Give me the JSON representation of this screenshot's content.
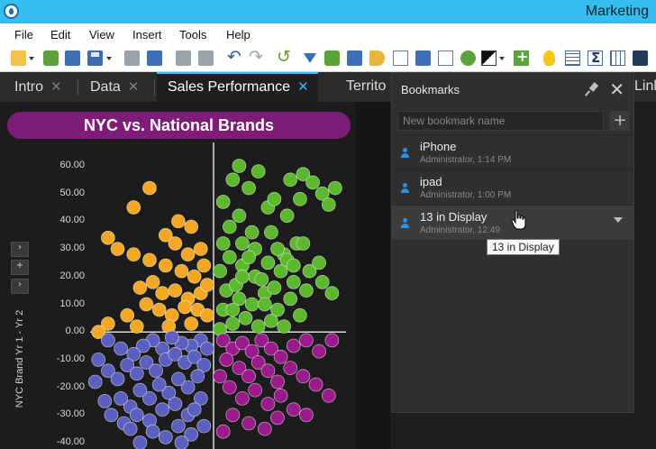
{
  "app": {
    "title": "Marketing"
  },
  "menu": [
    "File",
    "Edit",
    "View",
    "Insert",
    "Tools",
    "Help"
  ],
  "tabs": [
    {
      "label": "Intro",
      "active": false
    },
    {
      "label": "Data",
      "active": false
    },
    {
      "label": "Sales Performance",
      "active": true
    },
    {
      "label": "Territo",
      "active": false
    }
  ],
  "tab_overflow": "Link",
  "colors": {
    "accent": "#35bdf0",
    "title_bar": "#7e1d77",
    "q1_green": "#5cb82c",
    "q2_orange": "#f5a623",
    "q3_blue": "#5b5fc0",
    "q4_purple": "#9b1b8c"
  },
  "chart": {
    "title": "NYC vs. National Brands",
    "ylabel": "NYC Brand Yr 1 - Yr 2",
    "side_controls": [
      "›",
      "+",
      "›"
    ]
  },
  "chart_data": {
    "type": "scatter",
    "title": "NYC vs. National Brands",
    "xlabel": "",
    "ylabel": "NYC Brand Yr 1 - Yr 2",
    "y_ticks": [
      "60.00",
      "50.00",
      "40.00",
      "30.00",
      "20.00",
      "10.00",
      "0.00",
      "-10.00",
      "-20.00",
      "-30.00",
      "-40.00"
    ],
    "ylim": [
      -42,
      68
    ],
    "xlim": [
      -40,
      40
    ],
    "grid": false,
    "series": [
      {
        "color": "#5cb82c",
        "points": [
          [
            3,
            47
          ],
          [
            6,
            55
          ],
          [
            8,
            60
          ],
          [
            11,
            52
          ],
          [
            14,
            58
          ],
          [
            17,
            45
          ],
          [
            19,
            48
          ],
          [
            24,
            55
          ],
          [
            28,
            57
          ],
          [
            31,
            54
          ],
          [
            34,
            50
          ],
          [
            36,
            46
          ],
          [
            38,
            52
          ],
          [
            27,
            48
          ],
          [
            23,
            42
          ],
          [
            5,
            38
          ],
          [
            9,
            32
          ],
          [
            13,
            30
          ],
          [
            18,
            36
          ],
          [
            22,
            28
          ],
          [
            26,
            32
          ],
          [
            30,
            22
          ],
          [
            34,
            18
          ],
          [
            37,
            14
          ],
          [
            33,
            25
          ],
          [
            29,
            15
          ],
          [
            25,
            18
          ],
          [
            21,
            22
          ],
          [
            17,
            25
          ],
          [
            13,
            20
          ],
          [
            9,
            24
          ],
          [
            5,
            27
          ],
          [
            2,
            22
          ],
          [
            4,
            15
          ],
          [
            8,
            12
          ],
          [
            12,
            10
          ],
          [
            16,
            14
          ],
          [
            20,
            8
          ],
          [
            24,
            12
          ],
          [
            27,
            6
          ],
          [
            22,
            2
          ],
          [
            18,
            4
          ],
          [
            14,
            2
          ],
          [
            10,
            5
          ],
          [
            6,
            3
          ],
          [
            3,
            8
          ],
          [
            2,
            1
          ],
          [
            7,
            17
          ],
          [
            11,
            27
          ],
          [
            15,
            19
          ],
          [
            19,
            16
          ],
          [
            23,
            26
          ],
          [
            6,
            8
          ],
          [
            9,
            20
          ],
          [
            16,
            10
          ],
          [
            20,
            30
          ],
          [
            12,
            36
          ],
          [
            8,
            42
          ],
          [
            3,
            32
          ],
          [
            25,
            24
          ],
          [
            28,
            32
          ]
        ]
      },
      {
        "color": "#f5a623",
        "points": [
          [
            -20,
            52
          ],
          [
            -25,
            45
          ],
          [
            -33,
            34
          ],
          [
            -30,
            30
          ],
          [
            -25,
            28
          ],
          [
            -20,
            26
          ],
          [
            -15,
            35
          ],
          [
            -11,
            40
          ],
          [
            -7,
            38
          ],
          [
            -12,
            32
          ],
          [
            -8,
            28
          ],
          [
            -4,
            30
          ],
          [
            -15,
            24
          ],
          [
            -10,
            22
          ],
          [
            -6,
            20
          ],
          [
            -3,
            24
          ],
          [
            -19,
            18
          ],
          [
            -23,
            16
          ],
          [
            -16,
            14
          ],
          [
            -12,
            15
          ],
          [
            -8,
            12
          ],
          [
            -4,
            14
          ],
          [
            -2,
            17
          ],
          [
            -21,
            10
          ],
          [
            -17,
            8
          ],
          [
            -13,
            6
          ],
          [
            -9,
            9
          ],
          [
            -5,
            8
          ],
          [
            -2,
            6
          ],
          [
            -27,
            6
          ],
          [
            -33,
            3
          ],
          [
            -36,
            0
          ],
          [
            -24,
            2
          ],
          [
            -14,
            2
          ],
          [
            -7,
            3
          ]
        ]
      },
      {
        "color": "#5b5fc0",
        "points": [
          [
            -4,
            -3
          ],
          [
            -7,
            -5
          ],
          [
            -10,
            -4
          ],
          [
            -13,
            -2
          ],
          [
            -16,
            -6
          ],
          [
            -19,
            -3
          ],
          [
            -22,
            -5
          ],
          [
            -25,
            -8
          ],
          [
            -29,
            -6
          ],
          [
            -33,
            -3
          ],
          [
            -36,
            -10
          ],
          [
            -33,
            -14
          ],
          [
            -30,
            -17
          ],
          [
            -27,
            -12
          ],
          [
            -24,
            -15
          ],
          [
            -21,
            -11
          ],
          [
            -18,
            -14
          ],
          [
            -15,
            -10
          ],
          [
            -12,
            -8
          ],
          [
            -9,
            -11
          ],
          [
            -6,
            -9
          ],
          [
            -3,
            -12
          ],
          [
            -5,
            -16
          ],
          [
            -8,
            -20
          ],
          [
            -11,
            -17
          ],
          [
            -14,
            -22
          ],
          [
            -17,
            -19
          ],
          [
            -20,
            -24
          ],
          [
            -23,
            -21
          ],
          [
            -26,
            -27
          ],
          [
            -29,
            -24
          ],
          [
            -32,
            -30
          ],
          [
            -28,
            -33
          ],
          [
            -24,
            -30
          ],
          [
            -20,
            -32
          ],
          [
            -16,
            -28
          ],
          [
            -12,
            -26
          ],
          [
            -8,
            -30
          ],
          [
            -4,
            -24
          ],
          [
            -3,
            -34
          ],
          [
            -7,
            -37
          ],
          [
            -11,
            -34
          ],
          [
            -15,
            -38
          ],
          [
            -19,
            -36
          ],
          [
            -23,
            -40
          ],
          [
            -34,
            -25
          ],
          [
            -37,
            -18
          ],
          [
            -2,
            -6
          ],
          [
            -6,
            -28
          ],
          [
            -10,
            -40
          ],
          [
            -26,
            -35
          ]
        ]
      },
      {
        "color": "#9b1b8c",
        "points": [
          [
            3,
            -3
          ],
          [
            6,
            -6
          ],
          [
            9,
            -4
          ],
          [
            12,
            -7
          ],
          [
            15,
            -3
          ],
          [
            18,
            -6
          ],
          [
            21,
            -9
          ],
          [
            25,
            -5
          ],
          [
            29,
            -3
          ],
          [
            33,
            -7
          ],
          [
            37,
            -3
          ],
          [
            4,
            -10
          ],
          [
            8,
            -13
          ],
          [
            11,
            -16
          ],
          [
            14,
            -11
          ],
          [
            17,
            -14
          ],
          [
            20,
            -18
          ],
          [
            24,
            -13
          ],
          [
            28,
            -16
          ],
          [
            32,
            -19
          ],
          [
            36,
            -23
          ],
          [
            5,
            -20
          ],
          [
            9,
            -24
          ],
          [
            13,
            -21
          ],
          [
            17,
            -26
          ],
          [
            21,
            -23
          ],
          [
            25,
            -28
          ],
          [
            29,
            -30
          ],
          [
            6,
            -30
          ],
          [
            11,
            -33
          ],
          [
            16,
            -35
          ],
          [
            3,
            -36
          ],
          [
            20,
            -31
          ],
          [
            2,
            -16
          ]
        ]
      }
    ]
  },
  "bookmarks": {
    "title": "Bookmarks",
    "input_placeholder": "New bookmark name",
    "add_label": "+",
    "items": [
      {
        "name": "iPhone",
        "meta": "Administrator, 1:14 PM"
      },
      {
        "name": "ipad",
        "meta": "Administrator, 1:00 PM"
      },
      {
        "name": "13 in Display",
        "meta": "Administrator, 12:49"
      }
    ],
    "tooltip": "13 in Display"
  },
  "toolbar": {
    "icons": [
      "open-icon",
      "dropdown-icon",
      "import-icon",
      "refresh-data-icon",
      "save-icon",
      "dropdown-icon",
      "print-icon",
      "present-icon",
      "copy-icon",
      "paste-icon",
      "undo-icon",
      "redo-icon",
      "reload-icon",
      "filter-icon",
      "transform-icon",
      "layout-icon",
      "tag-icon",
      "insert-chart-icon",
      "duplicate-icon",
      "line-chart-icon",
      "comment-icon",
      "theme-icon",
      "dropdown-icon",
      "add-visual-icon",
      "insight-icon",
      "table-icon",
      "sigma-icon",
      "data-table-icon",
      "grid-icon"
    ]
  }
}
